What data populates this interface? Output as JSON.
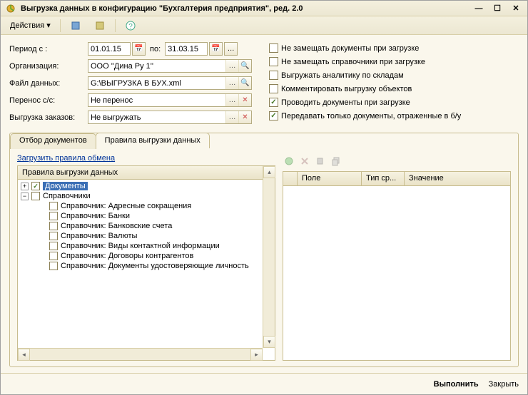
{
  "window": {
    "title": "Выгрузка данных в конфигурацию \"Бухгалтерия предприятия\", ред. 2.0"
  },
  "toolbar": {
    "actions": "Действия"
  },
  "form": {
    "period_label": "Период с :",
    "period_from": "01.01.15",
    "period_to_label": "по:",
    "period_to": "31.03.15",
    "org_label": "Организация:",
    "org_value": "ООО ''Дина Ру 1''",
    "file_label": "Файл данных:",
    "file_value": "G:\\ВЫГРУЗКА В БУХ.xml",
    "transfer_label": "Перенос с/с:",
    "transfer_value": "Не перенос",
    "orders_label": "Выгрузка заказов:",
    "orders_value": "Не выгружать"
  },
  "checks": {
    "c1": "Не замещать документы при загрузке",
    "c2": "Не замещать справочники при загрузке",
    "c3": "Выгружать аналитику по складам",
    "c4": "Комментировать выгрузку объектов",
    "c5": "Проводить документы при загрузке",
    "c6": "Передавать только документы, отраженные в б/у"
  },
  "tabs": {
    "t1": "Отбор документов",
    "t2": "Правила выгрузки данных"
  },
  "rules": {
    "load_link": "Загрузить правила обмена",
    "header": "Правила выгрузки данных",
    "node_docs": "Документы",
    "node_refs": "Справочники",
    "items": [
      "Справочник: Адресные сокращения",
      "Справочник: Банки",
      "Справочник: Банковские счета",
      "Справочник: Валюты",
      "Справочник: Виды контактной информации",
      "Справочник: Договоры контрагентов",
      "Справочник: Документы удостоверяющие личность"
    ]
  },
  "grid": {
    "col1": "Поле",
    "col2": "Тип ср...",
    "col3": "Значение"
  },
  "footer": {
    "execute": "Выполнить",
    "close": "Закрыть"
  }
}
